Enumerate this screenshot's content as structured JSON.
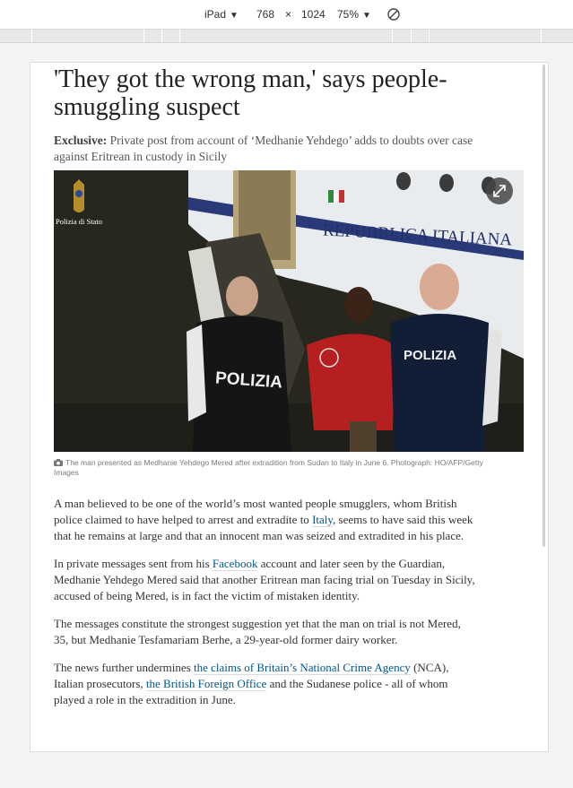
{
  "device_toolbar": {
    "device": "iPad",
    "width": "768",
    "times": "×",
    "height": "1024",
    "zoom": "75%"
  },
  "article": {
    "headline": "'They got the wrong man,' says people-smuggling suspect",
    "standfirst_label": "Exclusive:",
    "standfirst_text": " Private post from account of ‘Medhanie Yehdego’ adds to doubts over case against Eritrean in custody in Sicily",
    "photo": {
      "watermark": "Polizia di Stato",
      "plane_text": "REPUBBLICA ITALIANA",
      "vest_left": "POLIZIA",
      "vest_right": "POLIZIA"
    },
    "caption": "The man presented as Medhanie Yehdego Mered after extradition from Sudan to Italy in June 6. Photograph: HO/AFP/Getty Images",
    "paragraphs": {
      "p1": {
        "text1": "A man believed to be one of the world’s most wanted people smugglers, whom British police claimed to have helped to arrest and extradite to ",
        "link1": "Italy",
        "text2": ", seems to have said this week that he remains at large and that an innocent man was seized and extradited in his place."
      },
      "p2": {
        "text1": "In private messages sent from his ",
        "link1": "Facebook",
        "text2": " account and later seen by the Guardian, Medhanie Yehdego Mered said that another Eritrean man facing trial on Tuesday in Sicily, accused of being Mered, is in fact the victim of mistaken identity."
      },
      "p3": {
        "text1": "The messages constitute the strongest suggestion yet that the man on trial is not Mered, 35, but Medhanie Tesfamariam Berhe, a 29-year-old former dairy worker."
      },
      "p4": {
        "text1": "The news further undermines ",
        "link1": "the claims of Britain’s National Crime Agency",
        "text2": " (NCA), Italian prosecutors, ",
        "link2": "the British Foreign Office",
        "text3": " and the Sudanese police - all of whom played a role in the extradition in June."
      }
    }
  },
  "colors": {
    "link": "#005689",
    "headline": "#222222"
  }
}
